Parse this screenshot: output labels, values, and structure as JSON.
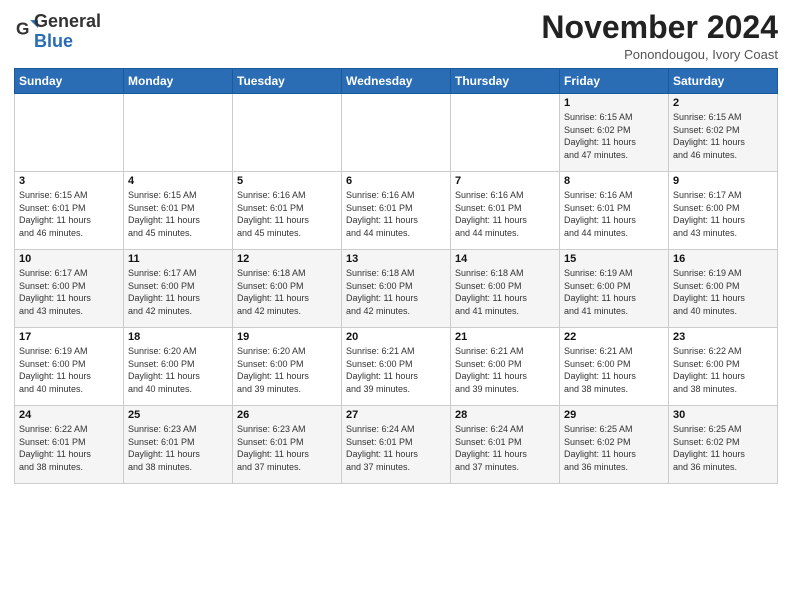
{
  "logo": {
    "general": "General",
    "blue": "Blue"
  },
  "header": {
    "month": "November 2024",
    "location": "Ponondougou, Ivory Coast"
  },
  "weekdays": [
    "Sunday",
    "Monday",
    "Tuesday",
    "Wednesday",
    "Thursday",
    "Friday",
    "Saturday"
  ],
  "weeks": [
    [
      {
        "day": "",
        "info": ""
      },
      {
        "day": "",
        "info": ""
      },
      {
        "day": "",
        "info": ""
      },
      {
        "day": "",
        "info": ""
      },
      {
        "day": "",
        "info": ""
      },
      {
        "day": "1",
        "info": "Sunrise: 6:15 AM\nSunset: 6:02 PM\nDaylight: 11 hours\nand 47 minutes."
      },
      {
        "day": "2",
        "info": "Sunrise: 6:15 AM\nSunset: 6:02 PM\nDaylight: 11 hours\nand 46 minutes."
      }
    ],
    [
      {
        "day": "3",
        "info": "Sunrise: 6:15 AM\nSunset: 6:01 PM\nDaylight: 11 hours\nand 46 minutes."
      },
      {
        "day": "4",
        "info": "Sunrise: 6:15 AM\nSunset: 6:01 PM\nDaylight: 11 hours\nand 45 minutes."
      },
      {
        "day": "5",
        "info": "Sunrise: 6:16 AM\nSunset: 6:01 PM\nDaylight: 11 hours\nand 45 minutes."
      },
      {
        "day": "6",
        "info": "Sunrise: 6:16 AM\nSunset: 6:01 PM\nDaylight: 11 hours\nand 44 minutes."
      },
      {
        "day": "7",
        "info": "Sunrise: 6:16 AM\nSunset: 6:01 PM\nDaylight: 11 hours\nand 44 minutes."
      },
      {
        "day": "8",
        "info": "Sunrise: 6:16 AM\nSunset: 6:01 PM\nDaylight: 11 hours\nand 44 minutes."
      },
      {
        "day": "9",
        "info": "Sunrise: 6:17 AM\nSunset: 6:00 PM\nDaylight: 11 hours\nand 43 minutes."
      }
    ],
    [
      {
        "day": "10",
        "info": "Sunrise: 6:17 AM\nSunset: 6:00 PM\nDaylight: 11 hours\nand 43 minutes."
      },
      {
        "day": "11",
        "info": "Sunrise: 6:17 AM\nSunset: 6:00 PM\nDaylight: 11 hours\nand 42 minutes."
      },
      {
        "day": "12",
        "info": "Sunrise: 6:18 AM\nSunset: 6:00 PM\nDaylight: 11 hours\nand 42 minutes."
      },
      {
        "day": "13",
        "info": "Sunrise: 6:18 AM\nSunset: 6:00 PM\nDaylight: 11 hours\nand 42 minutes."
      },
      {
        "day": "14",
        "info": "Sunrise: 6:18 AM\nSunset: 6:00 PM\nDaylight: 11 hours\nand 41 minutes."
      },
      {
        "day": "15",
        "info": "Sunrise: 6:19 AM\nSunset: 6:00 PM\nDaylight: 11 hours\nand 41 minutes."
      },
      {
        "day": "16",
        "info": "Sunrise: 6:19 AM\nSunset: 6:00 PM\nDaylight: 11 hours\nand 40 minutes."
      }
    ],
    [
      {
        "day": "17",
        "info": "Sunrise: 6:19 AM\nSunset: 6:00 PM\nDaylight: 11 hours\nand 40 minutes."
      },
      {
        "day": "18",
        "info": "Sunrise: 6:20 AM\nSunset: 6:00 PM\nDaylight: 11 hours\nand 40 minutes."
      },
      {
        "day": "19",
        "info": "Sunrise: 6:20 AM\nSunset: 6:00 PM\nDaylight: 11 hours\nand 39 minutes."
      },
      {
        "day": "20",
        "info": "Sunrise: 6:21 AM\nSunset: 6:00 PM\nDaylight: 11 hours\nand 39 minutes."
      },
      {
        "day": "21",
        "info": "Sunrise: 6:21 AM\nSunset: 6:00 PM\nDaylight: 11 hours\nand 39 minutes."
      },
      {
        "day": "22",
        "info": "Sunrise: 6:21 AM\nSunset: 6:00 PM\nDaylight: 11 hours\nand 38 minutes."
      },
      {
        "day": "23",
        "info": "Sunrise: 6:22 AM\nSunset: 6:00 PM\nDaylight: 11 hours\nand 38 minutes."
      }
    ],
    [
      {
        "day": "24",
        "info": "Sunrise: 6:22 AM\nSunset: 6:01 PM\nDaylight: 11 hours\nand 38 minutes."
      },
      {
        "day": "25",
        "info": "Sunrise: 6:23 AM\nSunset: 6:01 PM\nDaylight: 11 hours\nand 38 minutes."
      },
      {
        "day": "26",
        "info": "Sunrise: 6:23 AM\nSunset: 6:01 PM\nDaylight: 11 hours\nand 37 minutes."
      },
      {
        "day": "27",
        "info": "Sunrise: 6:24 AM\nSunset: 6:01 PM\nDaylight: 11 hours\nand 37 minutes."
      },
      {
        "day": "28",
        "info": "Sunrise: 6:24 AM\nSunset: 6:01 PM\nDaylight: 11 hours\nand 37 minutes."
      },
      {
        "day": "29",
        "info": "Sunrise: 6:25 AM\nSunset: 6:02 PM\nDaylight: 11 hours\nand 36 minutes."
      },
      {
        "day": "30",
        "info": "Sunrise: 6:25 AM\nSunset: 6:02 PM\nDaylight: 11 hours\nand 36 minutes."
      }
    ]
  ]
}
